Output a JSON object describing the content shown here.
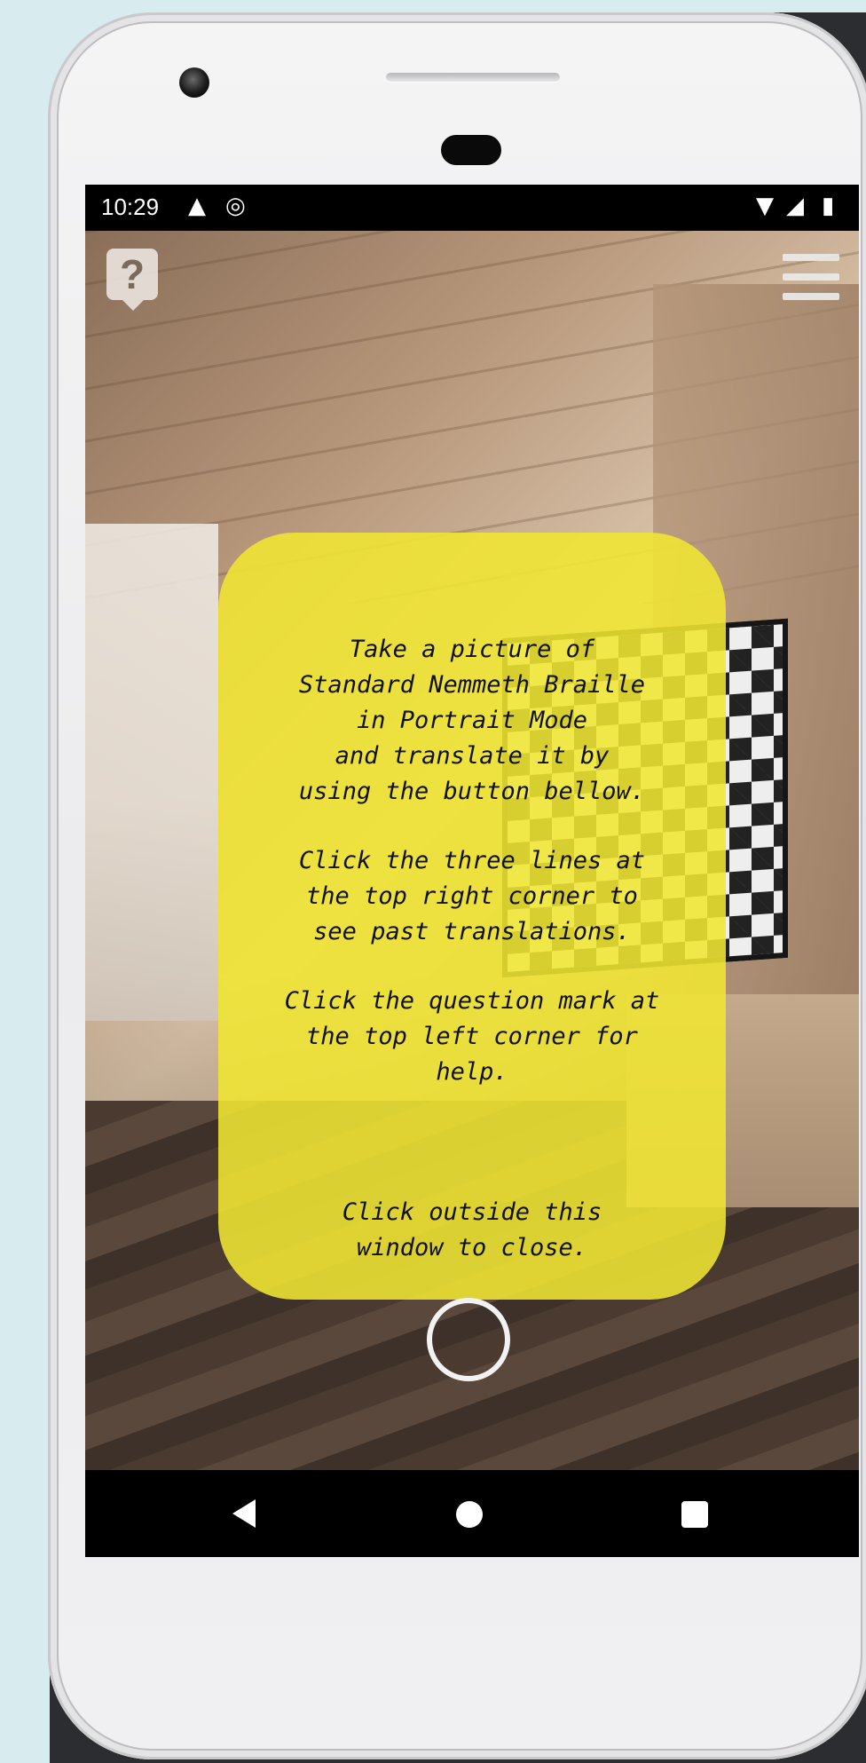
{
  "status_bar": {
    "time": "10:29",
    "left_icons": [
      "warning-icon",
      "do-not-disturb-icon"
    ],
    "right_icons": [
      "wifi-icon",
      "signal-icon",
      "battery-icon"
    ]
  },
  "toolbar": {
    "help_label": "?",
    "menu_icon": "hamburger-menu-icon"
  },
  "popup": {
    "paragraph_1": "Take a picture of\nStandard Nemmeth Braille\nin Portrait Mode\nand translate it by\nusing the button bellow.",
    "paragraph_2": "Click the three lines at\nthe top right corner to\nsee past translations.",
    "paragraph_3": "Click the question mark at\nthe top left corner for\nhelp.",
    "paragraph_4": "Click outside this\nwindow to close."
  },
  "camera": {
    "shutter_icon": "shutter-ring-icon"
  },
  "navigation": {
    "back_icon": "back-triangle-icon",
    "home_icon": "home-circle-icon",
    "recents_icon": "recents-square-icon"
  },
  "colors": {
    "popup_background": "#f0e632",
    "background": "#d8ebef",
    "status_bar": "#000000"
  }
}
